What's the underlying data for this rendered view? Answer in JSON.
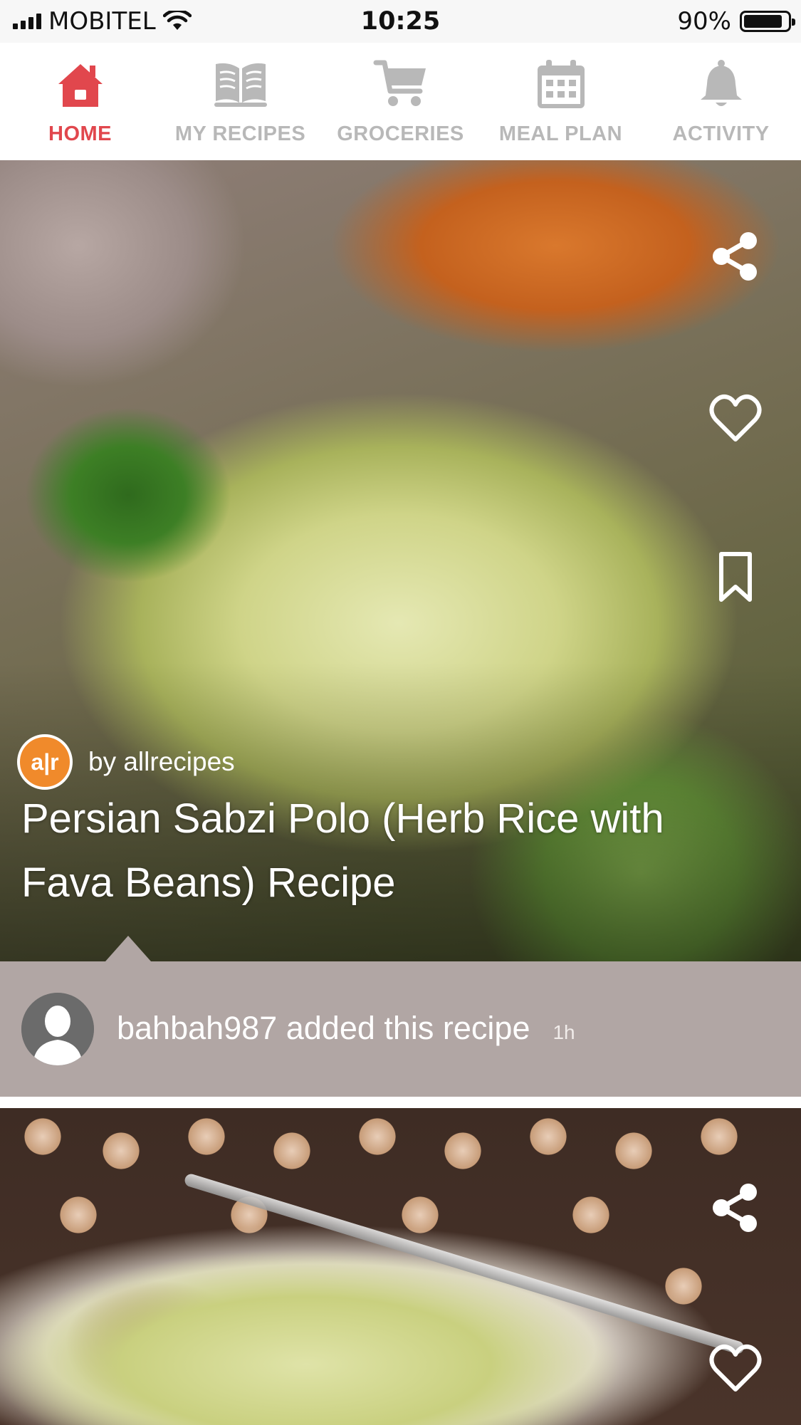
{
  "status_bar": {
    "carrier": "MOBITEL",
    "time": "10:25",
    "battery_percent_label": "90%",
    "battery_level": 0.9
  },
  "tabs": [
    {
      "label": "HOME",
      "icon": "home-icon",
      "active": true
    },
    {
      "label": "MY RECIPES",
      "icon": "book-icon",
      "active": false
    },
    {
      "label": "GROCERIES",
      "icon": "cart-icon",
      "active": false
    },
    {
      "label": "MEAL PLAN",
      "icon": "calendar-icon",
      "active": false
    },
    {
      "label": "ACTIVITY",
      "icon": "bell-icon",
      "active": false
    }
  ],
  "colors": {
    "accent": "#e1474d",
    "inactive_tab": "#b8b8b8",
    "activity_bar": "#b1a6a4",
    "source_logo": "#f08a2b"
  },
  "feed": [
    {
      "source_logo_text": "a|r",
      "source": "by allrecipes",
      "title": "Persian Sabzi Polo (Herb Rice with Fava Beans) Recipe",
      "actions": [
        "share-icon",
        "heart-icon",
        "bookmark-icon"
      ],
      "activity": {
        "text": "bahbah987 added this recipe",
        "time": "1h"
      }
    },
    {
      "actions": [
        "share-icon",
        "heart-icon"
      ]
    }
  ]
}
